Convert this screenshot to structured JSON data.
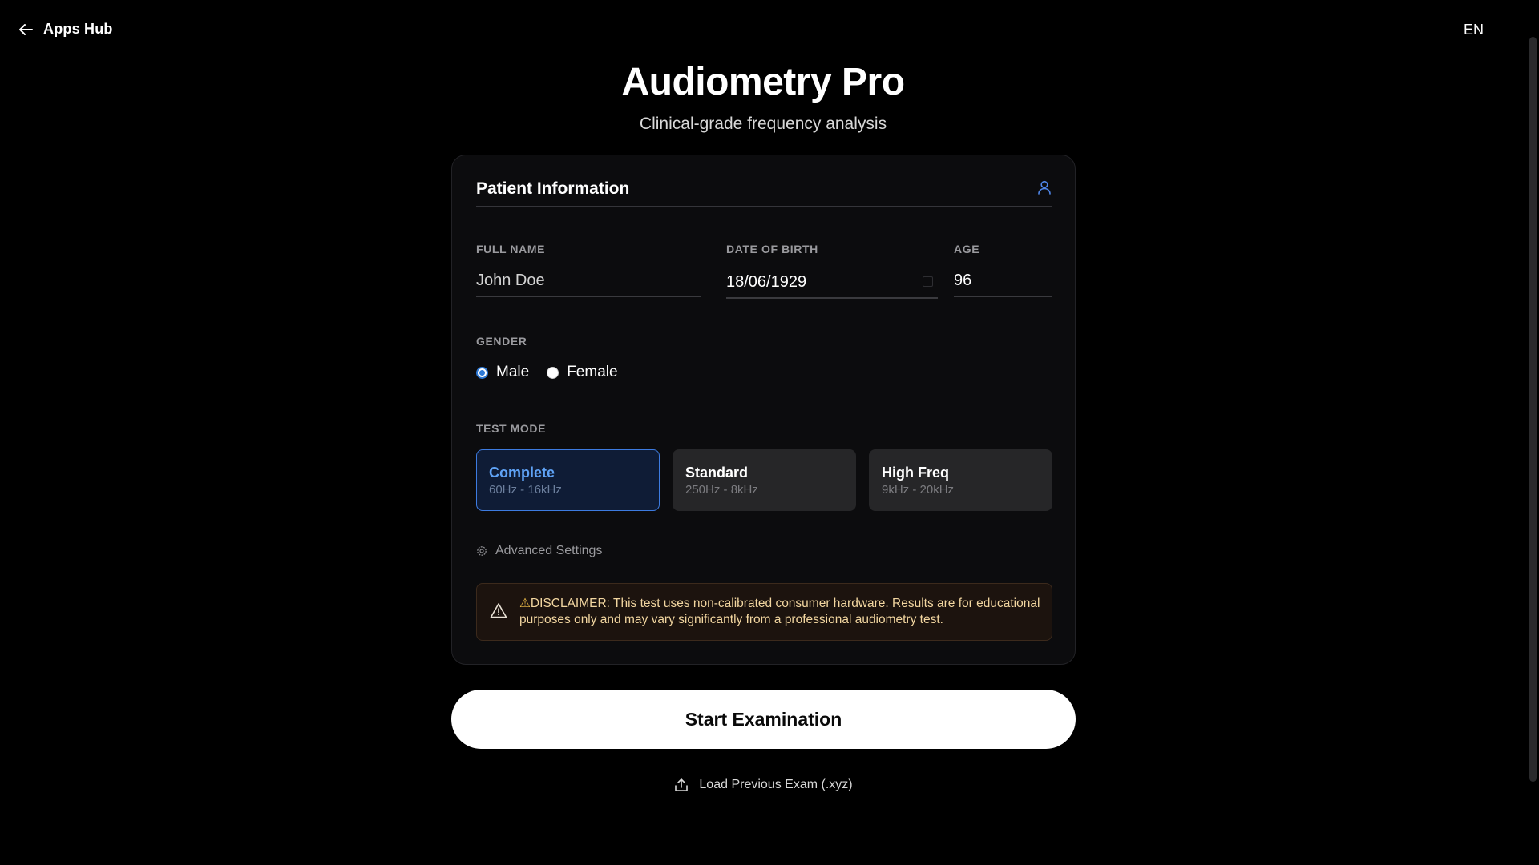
{
  "topbar": {
    "back_label": "Apps Hub",
    "language": "EN"
  },
  "header": {
    "title": "Audiometry Pro",
    "subtitle": "Clinical-grade frequency analysis"
  },
  "patient": {
    "section_title": "Patient Information",
    "full_name": {
      "label": "FULL NAME",
      "value": "John Doe"
    },
    "dob": {
      "label": "DATE OF BIRTH",
      "value": "18/06/1929"
    },
    "age": {
      "label": "AGE",
      "value": "96"
    },
    "gender": {
      "label": "GENDER",
      "options": [
        {
          "label": "Male",
          "selected": true
        },
        {
          "label": "Female",
          "selected": false
        }
      ]
    }
  },
  "test_mode": {
    "label": "TEST MODE",
    "options": [
      {
        "name": "Complete",
        "range": "60Hz - 16kHz",
        "active": true
      },
      {
        "name": "Standard",
        "range": "250Hz - 8kHz",
        "active": false
      },
      {
        "name": "High Freq",
        "range": "9kHz - 20kHz",
        "active": false
      }
    ]
  },
  "advanced_settings_label": "Advanced Settings",
  "disclaimer": {
    "text": "DISCLAIMER: This test uses non-calibrated consumer hardware. Results are for educational purposes only and may vary significantly from a professional audiometry test."
  },
  "actions": {
    "start_label": "Start Examination",
    "load_label": "Load Previous Exam (.xyz)"
  },
  "icons": {
    "back": "arrow-left-icon",
    "user": "user-icon",
    "calendar": "calendar-icon",
    "settings": "gear-icon",
    "warning": "warning-triangle-icon",
    "upload": "upload-icon"
  },
  "colors": {
    "background": "#000000",
    "card": "#0c0c0e",
    "accent": "#3d7be0",
    "accent_text": "#5fa2f5",
    "warning_bg": "#1c130e",
    "warning_text": "#f2d6a0"
  }
}
